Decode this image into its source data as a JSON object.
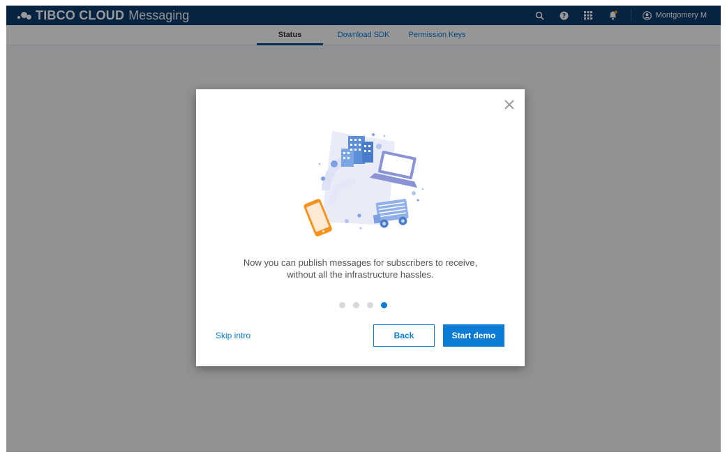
{
  "app": {
    "brand": "TIBCO CLOUD",
    "product": "Messaging",
    "user_name": "Montgomery M"
  },
  "topbar_icons": [
    "search-icon",
    "help-icon",
    "apps-grid-icon",
    "notification-bell-icon",
    "user-avatar-icon"
  ],
  "tabs": [
    {
      "label": "Status",
      "active": true
    },
    {
      "label": "Download SDK",
      "active": false
    },
    {
      "label": "Permission Keys",
      "active": false
    }
  ],
  "modal": {
    "message_line1": "Now you can publish messages for subscribers to receive,",
    "message_line2": "without all the infrastructure hassles.",
    "steps_total": 4,
    "current_step": 4,
    "skip_label": "Skip intro",
    "back_label": "Back",
    "start_label": "Start demo"
  },
  "colors": {
    "header_bg": "#0a3b6e",
    "accent": "#0b7bd6",
    "phone": "#f5931f",
    "laptop": "#8a93d4",
    "building": "#5e8fd9"
  }
}
